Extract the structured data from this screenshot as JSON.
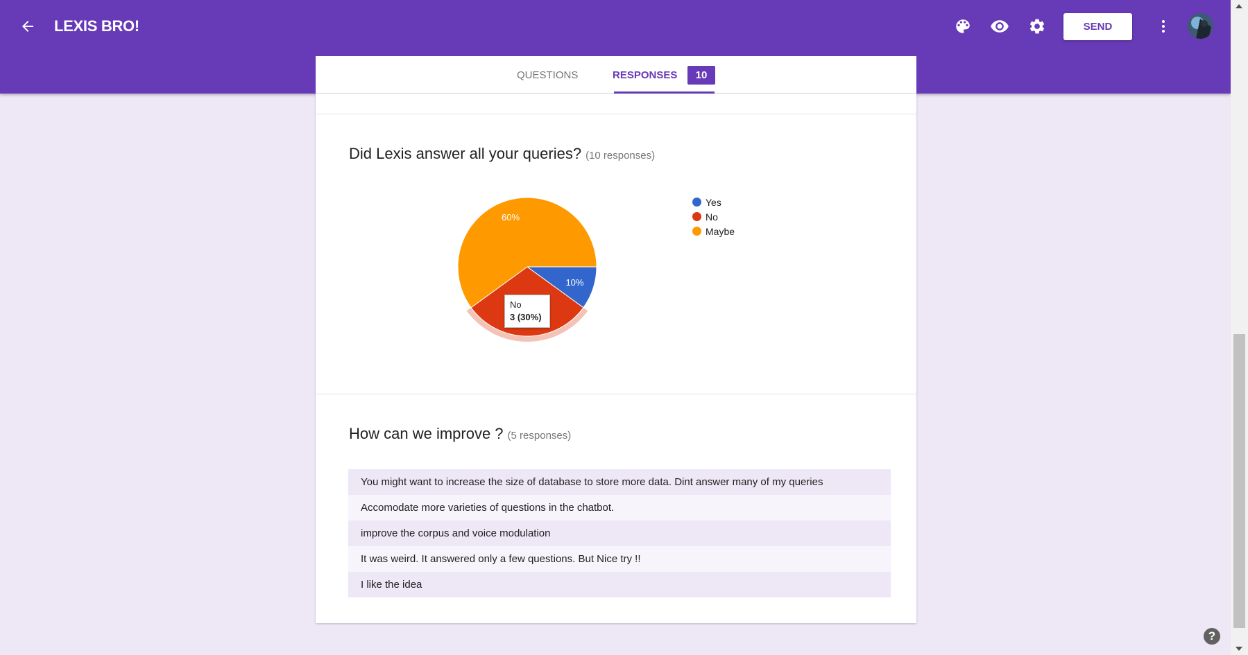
{
  "header": {
    "title": "LEXIS BRO!",
    "send_label": "SEND",
    "accent": "#673ab7",
    "icons": [
      "back-arrow-icon",
      "palette-icon",
      "eye-icon",
      "gear-icon",
      "more-vert-icon"
    ]
  },
  "tabs": {
    "questions_label": "QUESTIONS",
    "responses_label": "RESPONSES",
    "responses_count": "10"
  },
  "question1": {
    "title": "Did Lexis answer all your queries?",
    "count": "(10 responses)"
  },
  "question2": {
    "title": "How can we improve ?",
    "count": "(5 responses)",
    "answers": [
      "You might want to increase the size of database to store more data. Dint answer many of my queries",
      "Accomodate more varieties of questions in the chatbot.",
      "improve the corpus and voice modulation",
      "It was weird. It answered only a few questions. But Nice try !!",
      "I like the idea"
    ]
  },
  "chart_data": {
    "type": "pie",
    "categories": [
      "Yes",
      "No",
      "Maybe"
    ],
    "values": [
      1,
      3,
      6
    ],
    "labels": [
      "10%",
      "30%",
      "60%"
    ],
    "colors": [
      "#3366cc",
      "#dc3912",
      "#ff9900"
    ],
    "legend": "right",
    "tooltip": {
      "title": "No",
      "value": "3 (30%)"
    }
  }
}
